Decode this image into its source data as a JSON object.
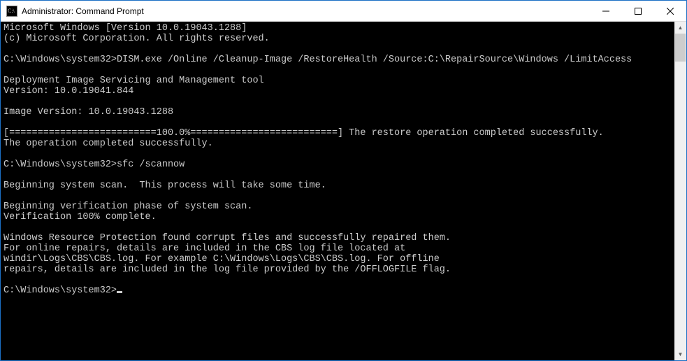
{
  "titlebar": {
    "icon_name": "cmd-icon",
    "title": "Administrator: Command Prompt"
  },
  "window_controls": {
    "minimize": "minimize",
    "maximize": "maximize",
    "close": "close"
  },
  "console": {
    "lines": [
      "Microsoft Windows [Version 10.0.19043.1288]",
      "(c) Microsoft Corporation. All rights reserved.",
      "",
      "C:\\Windows\\system32>DISM.exe /Online /Cleanup-Image /RestoreHealth /Source:C:\\RepairSource\\Windows /LimitAccess",
      "",
      "Deployment Image Servicing and Management tool",
      "Version: 10.0.19041.844",
      "",
      "Image Version: 10.0.19043.1288",
      "",
      "[==========================100.0%==========================] The restore operation completed successfully.",
      "The operation completed successfully.",
      "",
      "C:\\Windows\\system32>sfc /scannow",
      "",
      "Beginning system scan.  This process will take some time.",
      "",
      "Beginning verification phase of system scan.",
      "Verification 100% complete.",
      "",
      "Windows Resource Protection found corrupt files and successfully repaired them.",
      "For online repairs, details are included in the CBS log file located at",
      "windir\\Logs\\CBS\\CBS.log. For example C:\\Windows\\Logs\\CBS\\CBS.log. For offline",
      "repairs, details are included in the log file provided by the /OFFLOGFILE flag.",
      "",
      "C:\\Windows\\system32>"
    ],
    "prompt_path": "C:\\Windows\\system32>",
    "cursor": true
  },
  "scrollbar": {
    "up": "▲",
    "down": "▼"
  }
}
